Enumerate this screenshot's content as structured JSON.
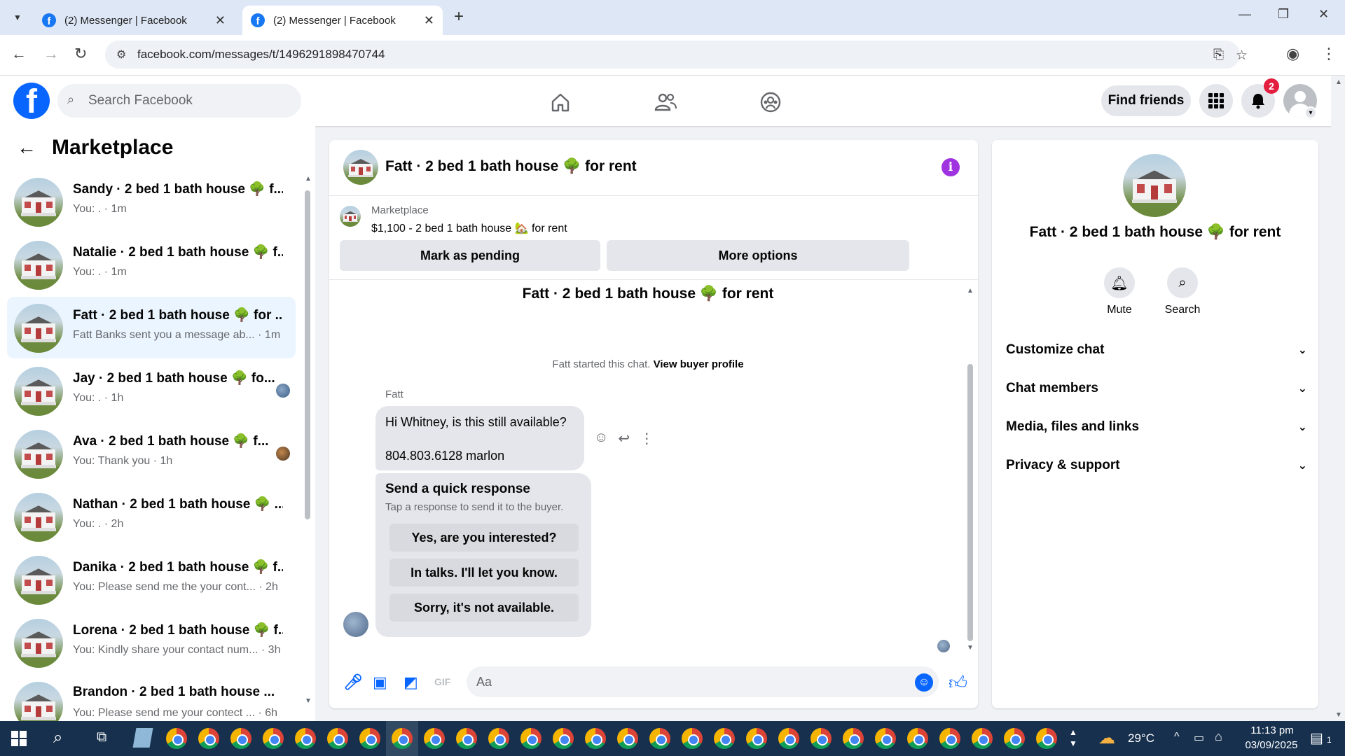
{
  "browser": {
    "tabs": [
      {
        "title": "(2) Messenger | Facebook",
        "active": false
      },
      {
        "title": "(2) Messenger | Facebook",
        "active": true
      }
    ],
    "url": "facebook.com/messages/t/1496291898470744"
  },
  "header": {
    "search_placeholder": "Search Facebook",
    "find_friends": "Find friends",
    "notification_count": "2"
  },
  "sidebar": {
    "title": "Marketplace",
    "conversations": [
      {
        "name": "Sandy · 2 bed 1 bath house 🌳 f...",
        "preview": "You: . · 1m",
        "active": false,
        "seen_avatar": false
      },
      {
        "name": "Natalie · 2 bed 1 bath house 🌳 f...",
        "preview": "You: . · 1m",
        "active": false,
        "seen_avatar": false
      },
      {
        "name": "Fatt · 2 bed 1 bath house 🌳 for ...",
        "preview": "Fatt Banks sent you a message ab... · 1m",
        "active": true,
        "seen_avatar": false
      },
      {
        "name": "Jay · 2 bed 1 bath house 🌳 fo...",
        "preview": "You: . · 1h",
        "active": false,
        "seen_avatar": true
      },
      {
        "name": "Ava · 2 bed 1 bath house 🌳 f...",
        "preview": "You: Thank you · 1h",
        "active": false,
        "seen_avatar": true
      },
      {
        "name": "Nathan · 2 bed 1 bath house 🌳 ...",
        "preview": "You: . · 2h",
        "active": false,
        "seen_avatar": false
      },
      {
        "name": "Danika · 2 bed 1 bath house 🌳 f...",
        "preview": "You: Please send me the your cont... · 2h",
        "active": false,
        "seen_avatar": false
      },
      {
        "name": "Lorena · 2 bed 1 bath house 🌳 f...",
        "preview": "You: Kindly share your contact num... · 3h",
        "active": false,
        "seen_avatar": false
      },
      {
        "name": "Brandon · 2 bed 1 bath house ...",
        "preview": "You: Please send me your contect ... · 6h",
        "active": false,
        "seen_avatar": false
      }
    ]
  },
  "chat": {
    "title": "Fatt · 2 bed 1 bath house 🌳 for rent",
    "marketplace_label": "Marketplace",
    "listing": "$1,100 - 2 bed 1 bath house 🏡 for rent",
    "mark_pending": "Mark as pending",
    "more_options": "More options",
    "thread_title": "Fatt · 2 bed 1 bath house 🌳 for rent",
    "started_text": "Fatt started this chat.",
    "view_buyer": "View buyer profile",
    "sender_name": "Fatt",
    "message_line1": "Hi Whitney, is this still available?",
    "message_line2": "804.803.6128 marlon",
    "quick_title": "Send a quick response",
    "quick_subtitle": "Tap a response to send it to the buyer.",
    "quick_responses": [
      "Yes, are you interested?",
      "In talks. I'll let you know.",
      "Sorry, it's not available."
    ],
    "composer_placeholder": "Aa"
  },
  "info_panel": {
    "title": "Fatt · 2 bed 1 bath house 🌳 for rent",
    "mute": "Mute",
    "search": "Search",
    "sections": [
      "Customize chat",
      "Chat members",
      "Media, files and links",
      "Privacy & support"
    ]
  },
  "taskbar": {
    "temperature": "29°C",
    "time": "11:13 pm",
    "date": "03/09/2025",
    "notification_count": "1"
  },
  "colors": {
    "fb_blue": "#0866ff",
    "active_convo": "#ebf5ff",
    "info_purple": "#a033e0",
    "badge_red": "#e41e3f"
  }
}
